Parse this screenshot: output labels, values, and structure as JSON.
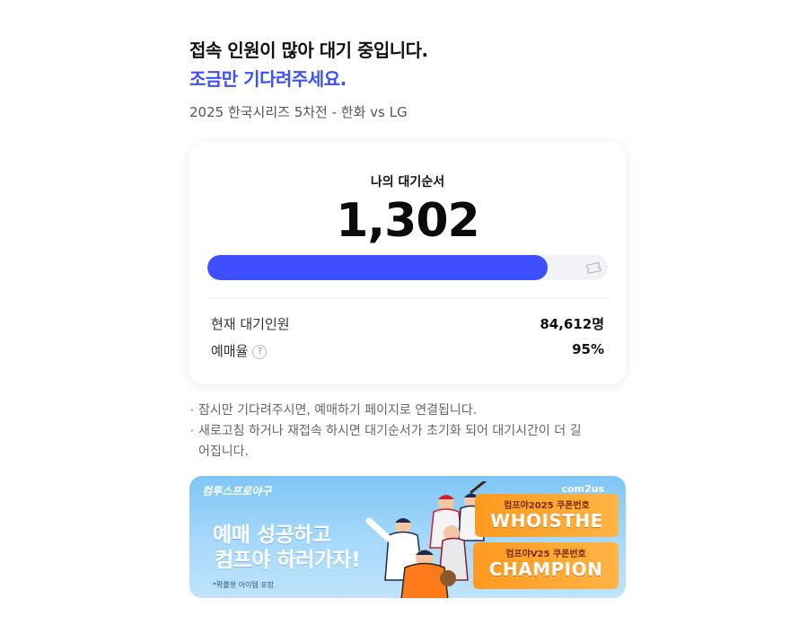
{
  "header": {
    "title": "접속 인원이 많아 대기 중입니다.",
    "subtitle": "조금만 기다려주세요.",
    "event": "2025 한국시리즈 5차전 - 한화 vs LG"
  },
  "queue": {
    "label": "나의 대기순서",
    "position": "1,302",
    "progress_fraction": 0.85,
    "current_waiting_label": "현재 대기인원",
    "current_waiting_value": "84,612명",
    "booking_rate_label": "예매율",
    "booking_rate_help": "?",
    "booking_rate_value": "95%"
  },
  "notes": [
    "잠시만 기다려주시면, 예매하기 페이지로 연결됩니다.",
    "새로고침 하거나 재접속 하시면 대기순서가 초기화 되어 대기시간이 더 길어집니다."
  ],
  "banner": {
    "logo": "컴투스프로야구",
    "brand": "com2us",
    "headline_1": "예매 성공하고",
    "headline_2": "컴프야 하러가자!",
    "fine_print": "*확률형 아이템 포함",
    "coupon_1_label": "컴프야2025 쿠폰번호",
    "coupon_1_code": "WHOISTHE",
    "coupon_2_label": "컴프야V25 쿠폰번호",
    "coupon_2_code": "CHAMPION"
  },
  "colors": {
    "accent": "#3d4fff",
    "progress_track": "#f2f3f7",
    "banner_sky": "#7fc6f5",
    "coupon_orange": "#ff9a1f"
  },
  "icons": {
    "ticket": "ticket-icon",
    "help": "question-circle-icon"
  }
}
